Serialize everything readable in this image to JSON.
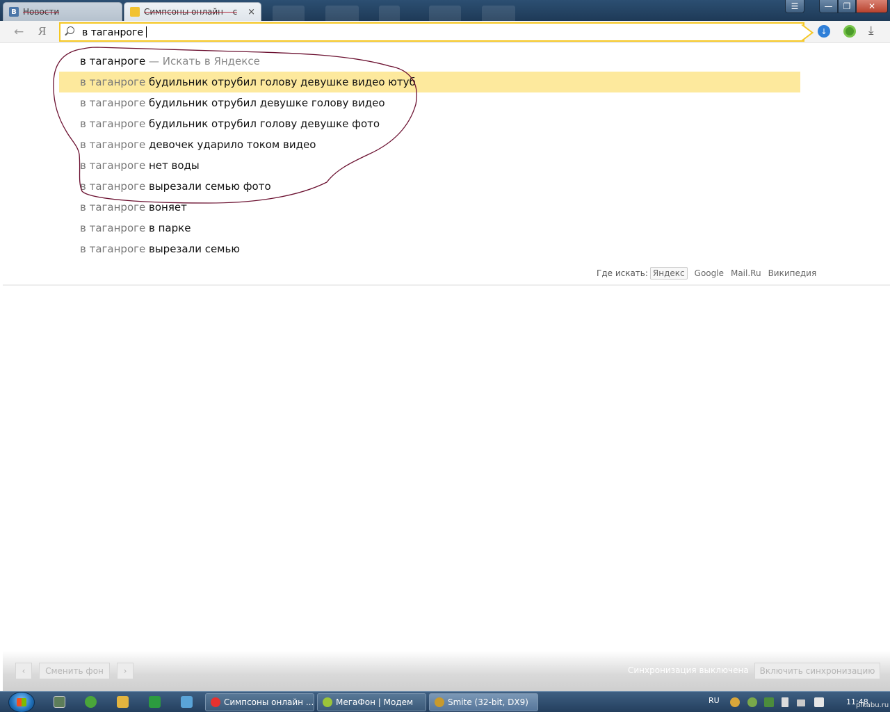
{
  "tabs": [
    {
      "title": "Новости",
      "favicon": "В",
      "favicon_color": "#4a76a8"
    },
    {
      "title": "Симпсоны онлайн – с",
      "favicon": "",
      "favicon_color": "#f2c230",
      "close": "×"
    }
  ],
  "window": {
    "menu": "☰",
    "minimize": "—",
    "maximize": "❐",
    "close": "✕"
  },
  "toolbar": {
    "back": "←",
    "ya_button": "Я",
    "download": "⤓"
  },
  "omnibox": {
    "value": "в таганроге"
  },
  "suggest": {
    "first": {
      "query": "в таганроге",
      "hint": " — Искать в Яндексе"
    },
    "items": [
      {
        "query": "в таганроге",
        "rest": " будильник отрубил голову девушке видео ютуб",
        "highlighted": true
      },
      {
        "query": "в таганроге",
        "rest": " будильник отрубил девушке голову видео"
      },
      {
        "query": "в таганроге",
        "rest": " будильник отрубил голову девушке фото"
      },
      {
        "query": "в таганроге",
        "rest": " девочек ударило током видео"
      },
      {
        "query": "в таганроге",
        "rest": " нет воды"
      },
      {
        "query": "в таганроге",
        "rest": " вырезали семью фото"
      },
      {
        "query": "в таганроге",
        "rest": " воняет"
      },
      {
        "query": "в таганроге",
        "rest": " в парке"
      },
      {
        "query": "в таганроге",
        "rest": " вырезали семью"
      }
    ],
    "where_label": "Где искать:",
    "engines": [
      "Яндекс",
      "Google",
      "Mail.Ru",
      "Википедия"
    ]
  },
  "bottom_bar": {
    "prev": "‹",
    "change_background": "Сменить фон",
    "next": "›",
    "sync_status": "Синхронизация выключена",
    "enable_sync": "Включить синхронизацию"
  },
  "taskbar": {
    "tasks": [
      {
        "label": "Симпсоны онлайн ...",
        "icon_color": "#e8312f"
      },
      {
        "label": "МегаФон | Модем",
        "icon_color": "#9bc43a"
      },
      {
        "label": "Smite (32-bit, DX9)",
        "icon_color": "#c89a2d",
        "active": true
      }
    ],
    "language": "RU",
    "clock": "11:48"
  },
  "watermark": "pikabu.ru"
}
